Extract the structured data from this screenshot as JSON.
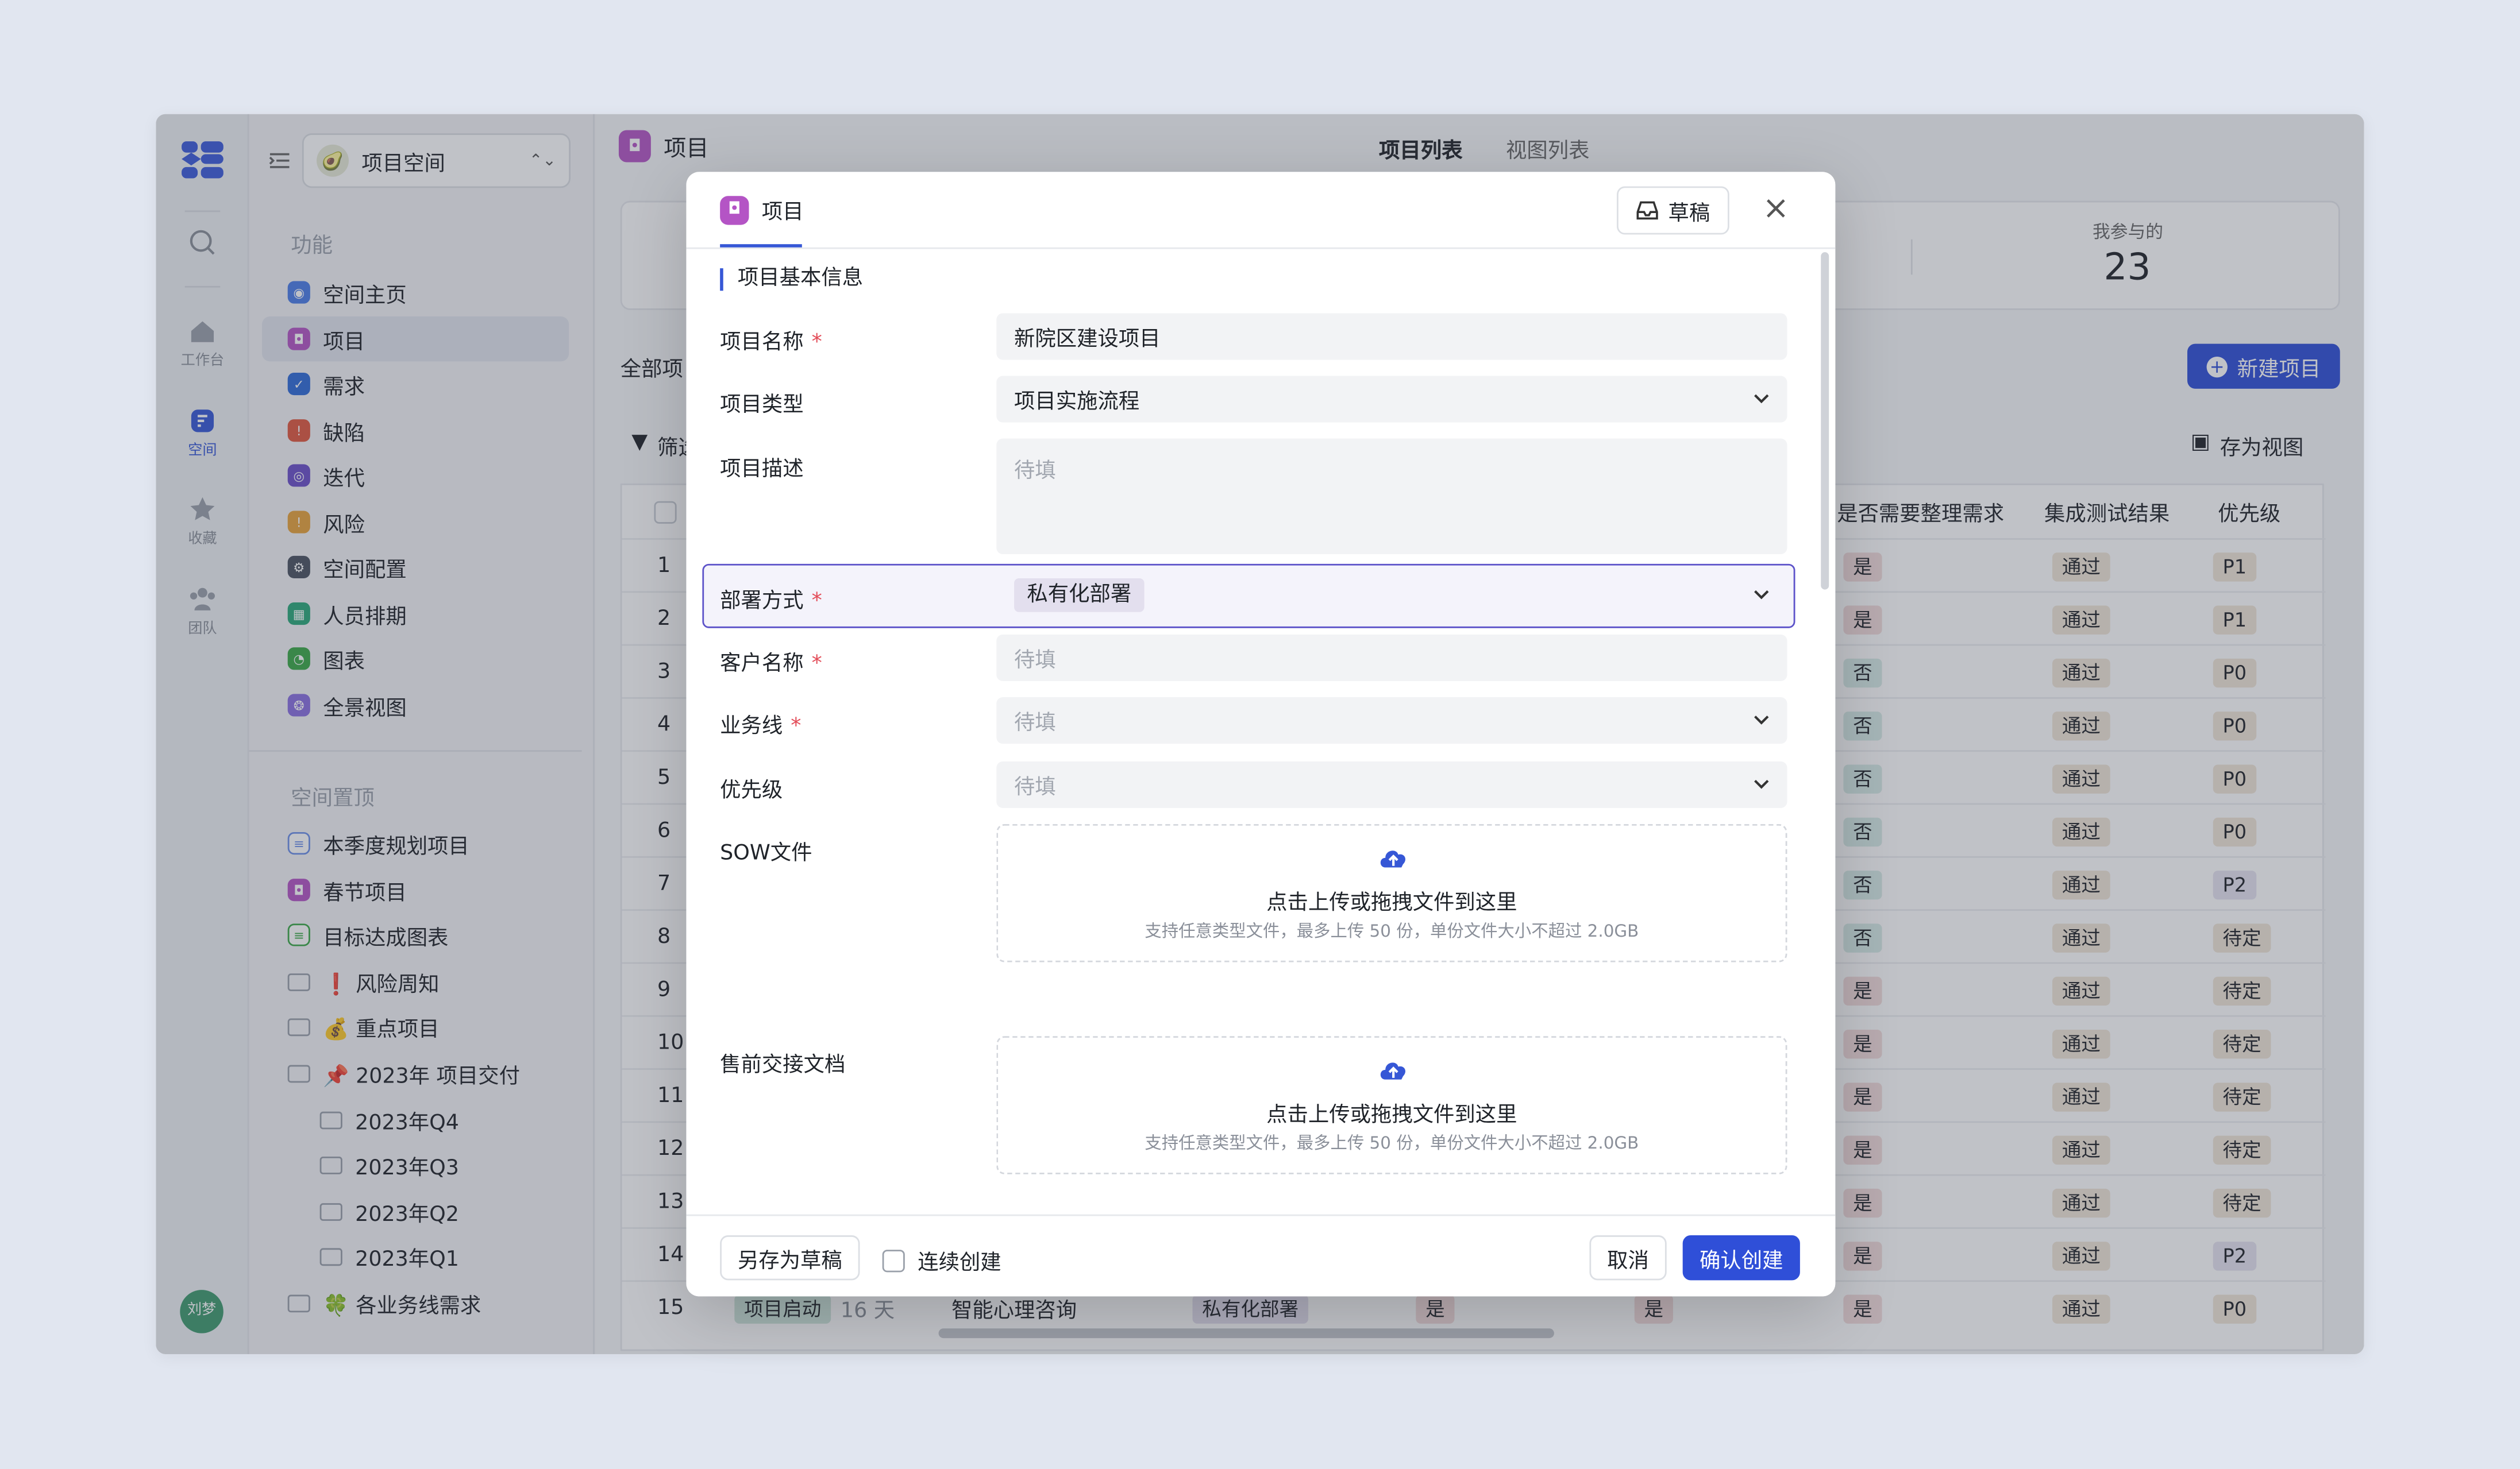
{
  "rail": {
    "items": [
      {
        "label": "工作台"
      },
      {
        "label": "空间"
      },
      {
        "label": "收藏"
      },
      {
        "label": "团队"
      }
    ],
    "avatar": "刘梦"
  },
  "sidebar": {
    "workspace": "项目空间",
    "section1": "功能",
    "items": [
      "空间主页",
      "项目",
      "需求",
      "缺陷",
      "迭代",
      "风险",
      "空间配置",
      "人员排期",
      "图表",
      "全景视图"
    ],
    "section2": "空间置顶",
    "pinned": [
      "本季度规划项目",
      "春节项目",
      "目标达成图表",
      "❗ 风险周知",
      "💰 重点项目",
      "📌 2023年 项目交付",
      "2023年Q4",
      "2023年Q3",
      "2023年Q2",
      "2023年Q1",
      "🍀 各业务线需求"
    ]
  },
  "header": {
    "title": "项目",
    "tabs": [
      "项目列表",
      "视图列表"
    ]
  },
  "stats": {
    "participating_label": "我参与的",
    "participating_value": "23"
  },
  "toolbar": {
    "all_tab": "全部项目",
    "filter": "筛选",
    "new_project": "新建项目",
    "save_view": "存为视图"
  },
  "table": {
    "columns": [
      "是否需要整理需求",
      "集成测试结果",
      "优先级"
    ],
    "rows": [
      [
        "1",
        "是",
        "通过",
        "P1"
      ],
      [
        "2",
        "是",
        "通过",
        "P1"
      ],
      [
        "3",
        "否",
        "通过",
        "P0"
      ],
      [
        "4",
        "否",
        "通过",
        "P0"
      ],
      [
        "5",
        "否",
        "通过",
        "P0"
      ],
      [
        "6",
        "否",
        "通过",
        "P0"
      ],
      [
        "7",
        "否",
        "通过",
        "P2"
      ],
      [
        "8",
        "否",
        "通过",
        "待定"
      ],
      [
        "9",
        "是",
        "通过",
        "待定"
      ],
      [
        "10",
        "是",
        "通过",
        "待定"
      ],
      [
        "11",
        "是",
        "通过",
        "待定"
      ],
      [
        "12",
        "是",
        "通过",
        "待定"
      ],
      [
        "13",
        "是",
        "通过",
        "待定"
      ],
      [
        "14",
        "是",
        "通过",
        "P2"
      ],
      [
        "15",
        "是",
        "通过",
        "P0"
      ]
    ],
    "last_row": {
      "stage": "项目启动",
      "days": "16 天",
      "name": "智能心理咨询",
      "deploy": "私有化部署",
      "a": "是",
      "b": "是"
    }
  },
  "modal": {
    "tab": "项目",
    "draft": "草稿",
    "section": "项目基本信息",
    "fields": {
      "name_label": "项目名称",
      "name_value": "新院区建设项目",
      "type_label": "项目类型",
      "type_value": "项目实施流程",
      "desc_label": "项目描述",
      "desc_placeholder": "待填",
      "deploy_label": "部署方式",
      "deploy_value": "私有化部署",
      "customer_label": "客户名称",
      "customer_placeholder": "待填",
      "biz_label": "业务线",
      "biz_placeholder": "待填",
      "priority_label": "优先级",
      "priority_placeholder": "待填",
      "sow_label": "SOW文件",
      "presale_label": "售前交接文档"
    },
    "upload": {
      "title": "点击上传或拖拽文件到这里",
      "hint": "支持任意类型文件，最多上传 50 份，单份文件大小不超过 2.0GB"
    },
    "footer": {
      "save_draft": "另存为草稿",
      "continuous": "连续创建",
      "cancel": "取消",
      "confirm": "确认创建"
    }
  },
  "colors": {
    "primary": "#2f4fd8",
    "project_icon": "#b454c5",
    "highlight_border": "#5c52c9"
  }
}
